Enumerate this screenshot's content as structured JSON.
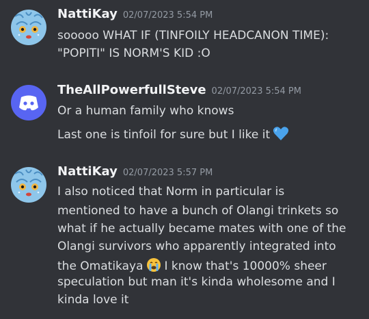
{
  "messages": [
    {
      "author": "NattiKay",
      "timestamp": "02/07/2023 5:54 PM",
      "avatar_icon": "nattikay-avatar-icon",
      "lines": [
        "sooooo WHAT IF (TINFOILY HEADCANON TIME):",
        "\"POPITI\" IS NORM'S KID :O"
      ]
    },
    {
      "author": "TheAllPowerfullSteve",
      "timestamp": "02/07/2023 5:54 PM",
      "avatar_icon": "discord-logo-icon",
      "lines": [
        "Or a human family who knows",
        "Last one is tinfoil for sure but I like it"
      ],
      "emoji": "blue-heart-icon"
    },
    {
      "author": "NattiKay",
      "timestamp": "02/07/2023 5:57 PM",
      "avatar_icon": "nattikay-avatar-icon",
      "lines": [
        "I also noticed that Norm in particular is",
        "mentioned to have a bunch of Olangi trinkets so",
        "what if he actually became mates with one of the",
        "Olangi survivors who apparently integrated into",
        "the Omatikaya",
        "I know that's 10000% sheer",
        "speculation but man it's kinda wholesome and I",
        "kinda love it"
      ],
      "emoji": "crying-face-icon"
    }
  ],
  "colors": {
    "background": "#313338",
    "author": "#f2f3f5",
    "timestamp": "#949ba4",
    "text": "#dbdee1",
    "discord_blurple": "#5865f2"
  }
}
